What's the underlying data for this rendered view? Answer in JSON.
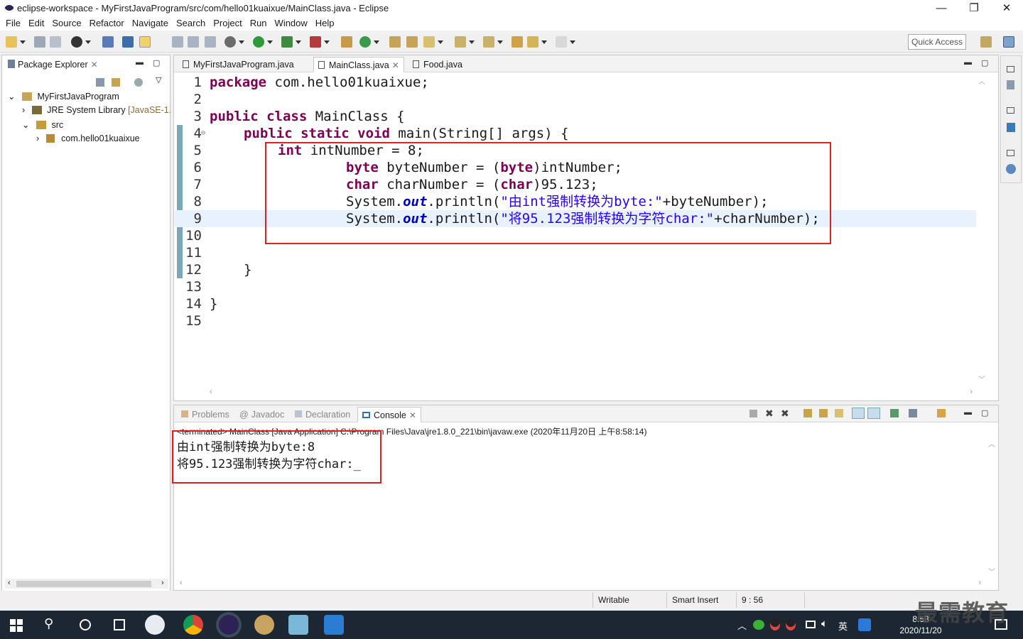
{
  "window": {
    "title": "eclipse-workspace - MyFirstJavaProgram/src/com/hello01kuaixue/MainClass.java - Eclipse",
    "minimize": "—",
    "restore": "❐",
    "close": "✕"
  },
  "menu": [
    "File",
    "Edit",
    "Source",
    "Refactor",
    "Navigate",
    "Search",
    "Project",
    "Run",
    "Window",
    "Help"
  ],
  "toolbar": {
    "quick_access": "Quick Access"
  },
  "package_explorer": {
    "title": "Package Explorer",
    "tree": [
      {
        "label": "MyFirstJavaProgram",
        "expander": "⌄"
      },
      {
        "label": "JRE System Library",
        "suffix": "[JavaSE-1.",
        "expander": "›"
      },
      {
        "label": "src",
        "expander": "⌄"
      },
      {
        "label": "com.hello01kuaixue",
        "expander": "›"
      }
    ]
  },
  "editor": {
    "tabs": [
      "MyFirstJavaProgram.java",
      "MainClass.java",
      "Food.java"
    ],
    "active_tab": 1,
    "lines": [
      {
        "n": "1"
      },
      {
        "n": "2"
      },
      {
        "n": "3"
      },
      {
        "n": "4"
      },
      {
        "n": "5"
      },
      {
        "n": "6"
      },
      {
        "n": "7"
      },
      {
        "n": "8"
      },
      {
        "n": "9"
      },
      {
        "n": "10"
      },
      {
        "n": "11"
      },
      {
        "n": "12"
      },
      {
        "n": "13"
      },
      {
        "n": "14"
      },
      {
        "n": "15"
      }
    ],
    "code": {
      "l1_kw": "package",
      "l1_rest": " com.hello01kuaixue;",
      "l3_kw": "public class",
      "l3_rest": " MainClass {",
      "l4_kw": "public static void",
      "l4_rest": " main(String[] args) {",
      "l5_kw": "int",
      "l5_rest": " intNumber = 8;",
      "l6_kw": "byte",
      "l6_mid": " byteNumber = (",
      "l6_kw2": "byte",
      "l6_rest": ")intNumber;",
      "l7_kw": "char",
      "l7_mid": " charNumber = (",
      "l7_kw2": "char",
      "l7_rest": ")95.123;",
      "l8_a": "System.",
      "l8_fld": "out",
      "l8_b": ".println(",
      "l8_str": "\"由int强制转换为byte:\"",
      "l8_c": "+byteNumber);",
      "l9_a": "System.",
      "l9_fld": "out",
      "l9_b": ".println(",
      "l9_str": "\"将95.123强制转换为字符char:\"",
      "l9_c": "+charNumber);",
      "l12": "}",
      "l14": "}"
    }
  },
  "bottom": {
    "tabs": [
      "Problems",
      "Javadoc",
      "Declaration",
      "Console"
    ],
    "active_tab": 3,
    "terminated": "<terminated> MainClass [Java Application] C:\\Program Files\\Java\\jre1.8.0_221\\bin\\javaw.exe (2020年11月20日 上午8:58:14)",
    "output": [
      "由int强制转换为byte:8",
      "将95.123强制转换为字符char:_"
    ]
  },
  "status": {
    "writable": "Writable",
    "insert": "Smart Insert",
    "position": "9 : 56"
  },
  "taskbar": {
    "time": "8:58",
    "date": "2020/11/20",
    "ime": "英",
    "watermark": "最需教育"
  },
  "colors": {
    "keyword": "#7f0055",
    "string": "#2a00ff",
    "field": "#0000c0",
    "highlight_box": "#e02020",
    "taskbar": "#1d2733"
  }
}
